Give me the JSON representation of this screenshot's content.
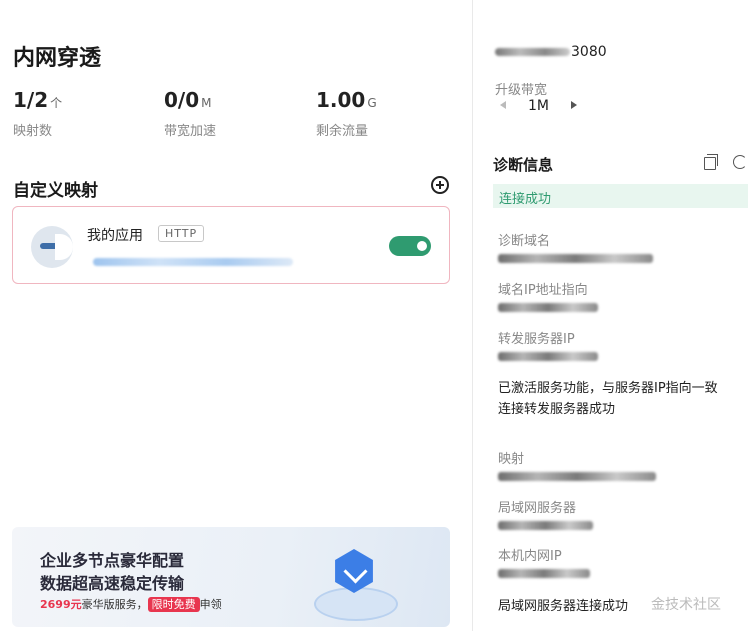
{
  "page": {
    "title": "内网穿透"
  },
  "stats": [
    {
      "value": "1/2",
      "unit": "个",
      "label": "映射数"
    },
    {
      "value": "0/0",
      "unit": "M",
      "label": "带宽加速"
    },
    {
      "value": "1.00",
      "unit": "G",
      "label": "剩余流量"
    }
  ],
  "custom_mapping": {
    "title": "自定义映射",
    "apps": [
      {
        "name": "我的应用",
        "protocol": "HTTP",
        "enabled": true
      }
    ]
  },
  "banner": {
    "line1": "企业多节点豪华配置",
    "line2": "数据超高速稳定传输",
    "price": "2699元",
    "service_text": "豪华版服务，",
    "limited_badge": "限时免费",
    "claim_text": "申领"
  },
  "right_panel": {
    "ip_suffix": "3080",
    "upgrade_label": "升级带宽",
    "bandwidth_value": "1M",
    "diag_title": "诊断信息",
    "status": "连接成功",
    "fields": [
      {
        "label": "诊断域名"
      },
      {
        "label": "域名IP地址指向"
      },
      {
        "label": "转发服务器IP"
      }
    ],
    "messages": [
      "已激活服务功能，与服务器IP指向一致",
      "连接转发服务器成功"
    ],
    "fields2": [
      {
        "label": "映射"
      },
      {
        "label": "局域网服务器"
      },
      {
        "label": "本机内网IP"
      }
    ],
    "final_message": "局域网服务器连接成功"
  },
  "watermark": "金技术社区",
  "colors": {
    "accent_green": "#2f9b70",
    "alert_red": "#e8364f",
    "card_border": "#f0b6c0"
  }
}
